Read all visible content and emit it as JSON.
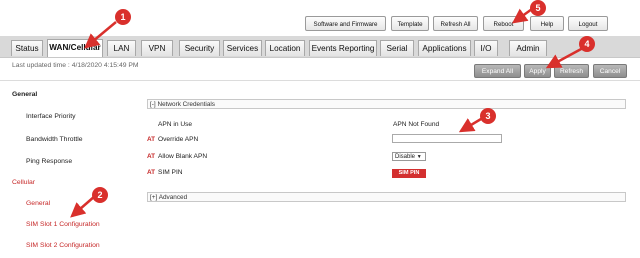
{
  "top_buttons": [
    "Software and Firmware",
    "Template",
    "Refresh All",
    "Reboot",
    "Help",
    "Logout"
  ],
  "tabs": [
    "Status",
    "WAN/Cellular",
    "LAN",
    "VPN",
    "Security",
    "Services",
    "Location",
    "Events Reporting",
    "Serial",
    "Applications",
    "I/O",
    "Admin"
  ],
  "active_tab": "WAN/Cellular",
  "last_updated": "Last updated time : 4/18/2020 4:15:49 PM",
  "action_buttons": [
    "Expand All",
    "Apply",
    "Refresh",
    "Cancel"
  ],
  "sidebar": {
    "general_heading": "General",
    "items": [
      "Interface Priority",
      "Bandwidth Throttle",
      "Ping Response"
    ],
    "cellular_heading": "Cellular",
    "cellular_items": [
      "General",
      "SIM Slot 1 Configuration",
      "SIM Slot 2 Configuration"
    ]
  },
  "network_credentials": {
    "header": "[-] Network Credentials",
    "rows": [
      {
        "at": "",
        "label": "APN in Use",
        "value": "APN Not Found"
      },
      {
        "at": "AT",
        "label": "Override APN",
        "value": ""
      },
      {
        "at": "AT",
        "label": "Allow Blank APN",
        "value": "Disable"
      },
      {
        "at": "AT",
        "label": "SIM PIN",
        "value": "SIM PIN"
      }
    ]
  },
  "advanced_header": "[+] Advanced",
  "select_arrow": "▼",
  "annotations": [
    "1",
    "2",
    "3",
    "4",
    "5"
  ],
  "colors": {
    "annotation": "#d9302c",
    "gray_button": "#9e9e9e",
    "red_link": "#c62828"
  }
}
